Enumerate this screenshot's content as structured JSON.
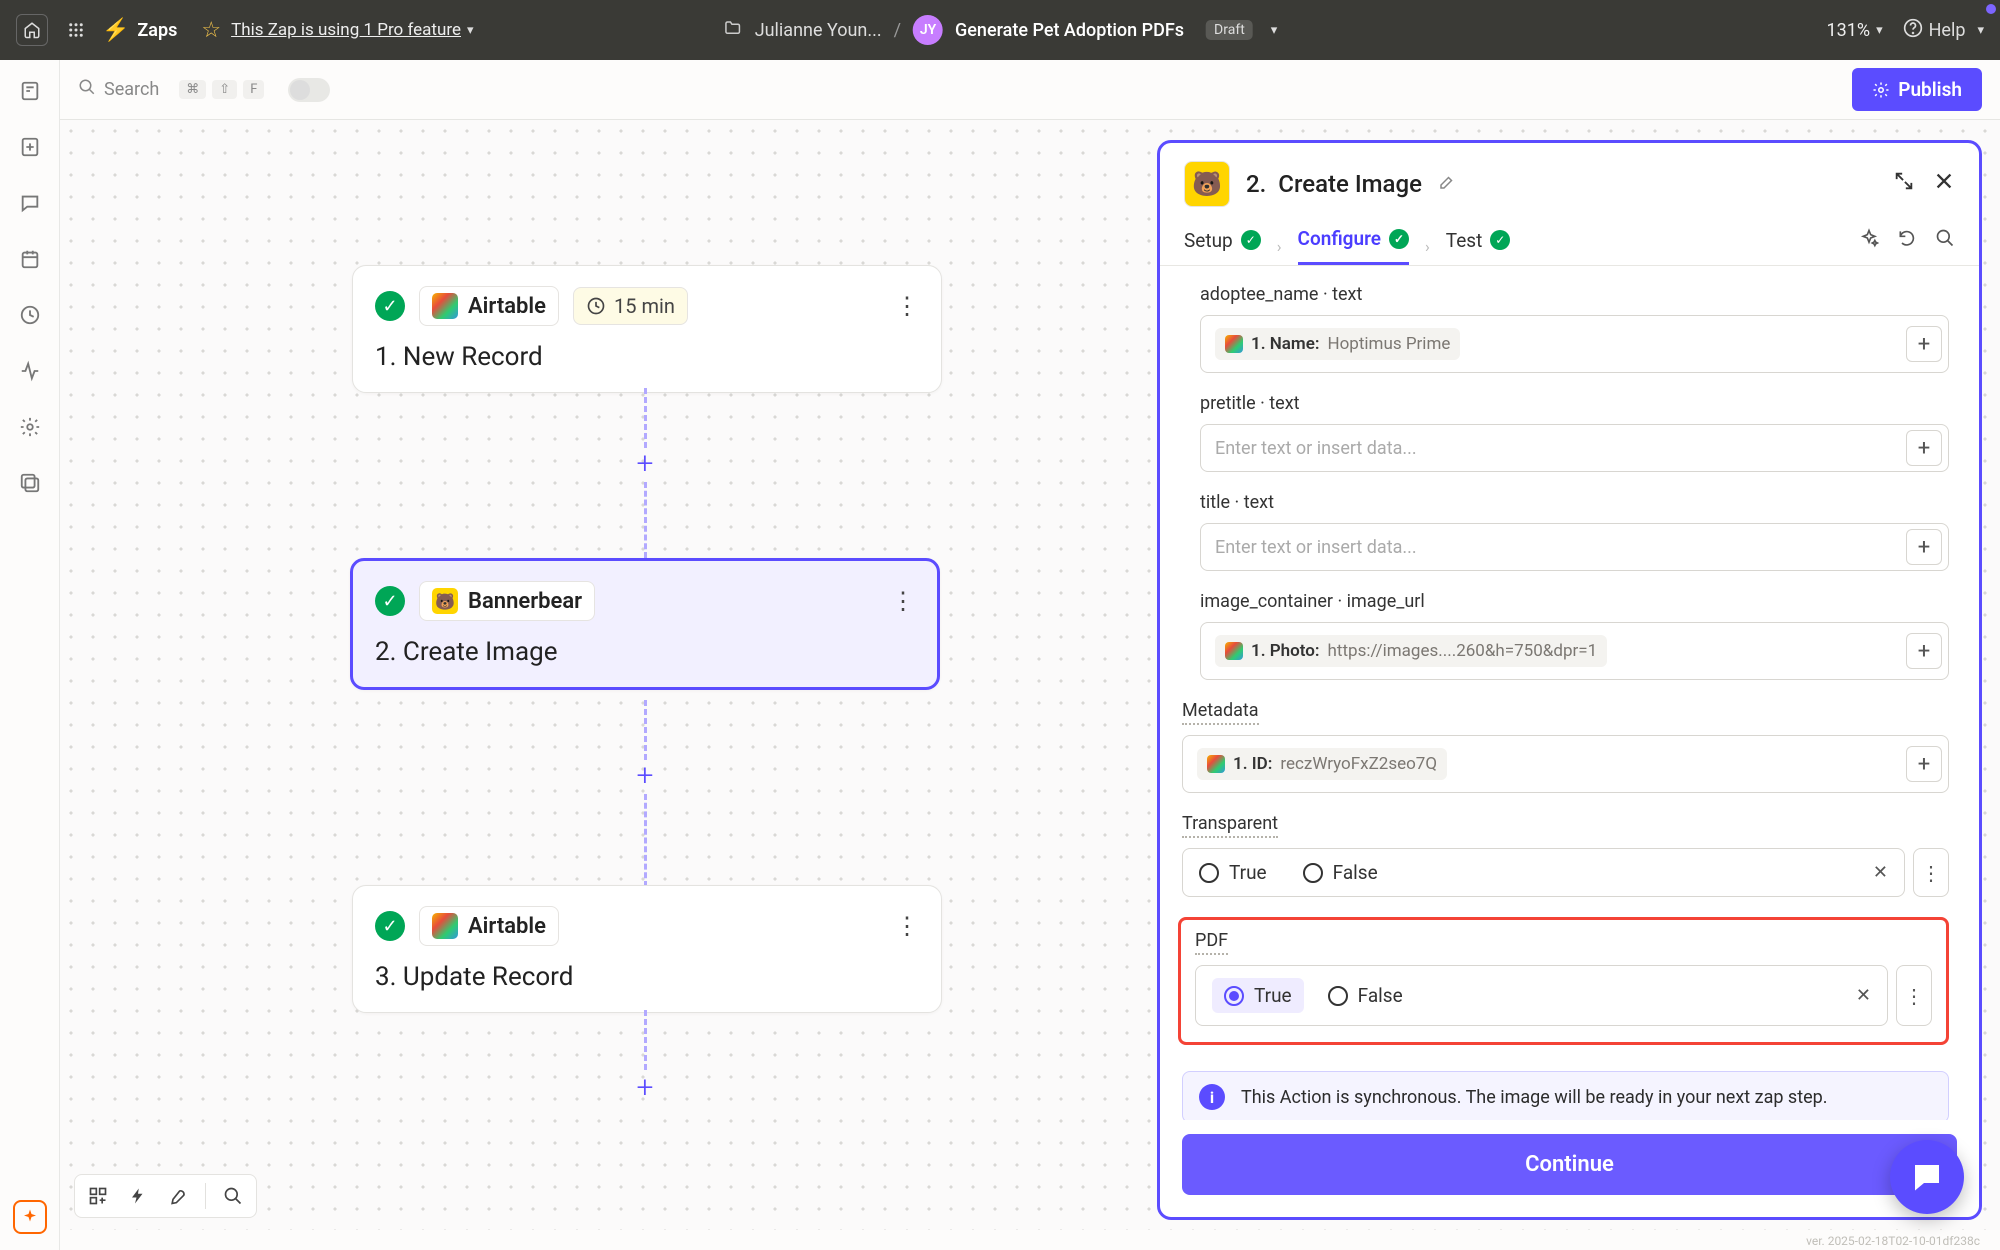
{
  "topbar": {
    "zaps": "Zaps",
    "pro_feature": "This Zap is using 1 Pro feature",
    "owner": "Julianne Youn...",
    "avatar_initials": "JY",
    "zap_name": "Generate Pet Adoption PDFs",
    "draft": "Draft",
    "zoom": "131%",
    "help": "Help"
  },
  "toolbar": {
    "search_placeholder": "Search",
    "kbd1": "⌘",
    "kbd2": "⇧",
    "kbd3": "F",
    "publish": "Publish"
  },
  "steps": {
    "s1": {
      "app": "Airtable",
      "timer": "15 min",
      "title": "1. New Record"
    },
    "s2": {
      "app": "Bannerbear",
      "title": "2. Create Image"
    },
    "s3": {
      "app": "Airtable",
      "title": "3. Update Record"
    }
  },
  "panel": {
    "header_num": "2.",
    "header_title": "Create Image",
    "tabs": {
      "setup": "Setup",
      "configure": "Configure",
      "test": "Test"
    },
    "fields": {
      "adoptee_label": "adoptee_name · text",
      "adoptee_pill_label": "1. Name:",
      "adoptee_pill_value": "Hoptimus Prime",
      "pretitle_label": "pretitle · text",
      "pretitle_placeholder": "Enter text or insert data...",
      "title_label": "title · text",
      "title_placeholder": "Enter text or insert data...",
      "image_label": "image_container · image_url",
      "image_pill_label": "1. Photo:",
      "image_pill_value": "https://images....260&h=750&dpr=1",
      "metadata_label": "Metadata",
      "metadata_pill_label": "1. ID:",
      "metadata_pill_value": "reczWryoFxZ2seo7Q",
      "transparent_label": "Transparent",
      "pdf_label": "PDF",
      "true": "True",
      "false": "False",
      "info_text": "This Action is synchronous. The image will be ready in your next zap step."
    },
    "continue": "Continue"
  },
  "footer_ver": "ver. 2025-02-18T02-10-01df238c"
}
